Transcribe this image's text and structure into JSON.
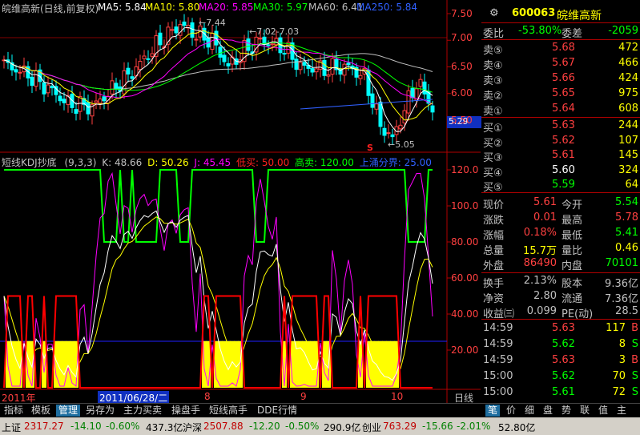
{
  "header": {
    "stock_title": "皖维高新(日线,前复权)",
    "ma": [
      {
        "label": "MA5: 5.84",
        "color": "#ffffff"
      },
      {
        "label": "MA10: 5.80",
        "color": "#ffff00"
      },
      {
        "label": "MA20: 5.85",
        "color": "#ff00ff"
      },
      {
        "label": "MA30: 5.97",
        "color": "#00ff00"
      },
      {
        "label": "MA60: 6.41",
        "color": "#c0c0c0"
      },
      {
        "label": "MA250: 5.84",
        "color": "#3060ff"
      }
    ]
  },
  "indicator": {
    "name": "短线KDJ抄底",
    "params": "(9,3,3)",
    "k": "K: 48.66",
    "d": "D: 50.26",
    "j": "J: 45.45",
    "dimai": "低买: 50.00",
    "gaomai": "高卖: 120.00",
    "shangyong": "上涌分界: 25.00"
  },
  "annotations": {
    "high1": "7.44",
    "high2": "7.02-7.03",
    "low1": "5.05",
    "s_mark": "S",
    "price_tag": "5.29"
  },
  "price_axis": [
    "7.50",
    "7.00",
    "6.50",
    "6.00",
    "5.50"
  ],
  "kdj_axis": [
    "120.0",
    "100.0",
    "80.00",
    "60.00",
    "40.00",
    "20.00"
  ],
  "date_axis": {
    "year": "2011年",
    "cursor_date": "2011/06/28/二",
    "months": [
      "8",
      "9",
      "10"
    ],
    "period": "日线"
  },
  "quote": {
    "code": "600063",
    "name": "皖维高新",
    "webi_label": "委比",
    "webi_value": "-53.80%",
    "weicha_label": "委差",
    "weicha_value": "-2059",
    "sell": [
      {
        "label": "卖⑤",
        "price": "5.68",
        "vol": "472"
      },
      {
        "label": "卖④",
        "price": "5.67",
        "vol": "466"
      },
      {
        "label": "卖③",
        "price": "5.66",
        "vol": "424"
      },
      {
        "label": "卖②",
        "price": "5.65",
        "vol": "975"
      },
      {
        "label": "卖①",
        "price": "5.64",
        "vol": "608"
      }
    ],
    "buy": [
      {
        "label": "买①",
        "price": "5.63",
        "vol": "244"
      },
      {
        "label": "买②",
        "price": "5.62",
        "vol": "107"
      },
      {
        "label": "买③",
        "price": "5.61",
        "vol": "145"
      },
      {
        "label": "买④",
        "price": "5.60",
        "vol": "324"
      },
      {
        "label": "买⑤",
        "price": "5.59",
        "vol": "64"
      }
    ],
    "stats": [
      {
        "l1": "现价",
        "v1": "5.61",
        "c1": "#ff4040",
        "l2": "今开",
        "v2": "5.54",
        "c2": "#00ff00"
      },
      {
        "l1": "涨跌",
        "v1": "0.01",
        "c1": "#ff4040",
        "l2": "最高",
        "v2": "5.78",
        "c2": "#ff4040"
      },
      {
        "l1": "涨幅",
        "v1": "0.18%",
        "c1": "#ff4040",
        "l2": "最低",
        "v2": "5.41",
        "c2": "#00ff00"
      },
      {
        "l1": "总量",
        "v1": "15.7万",
        "c1": "#ffff00",
        "l2": "量比",
        "v2": "0.46",
        "c2": "#ffff00"
      },
      {
        "l1": "外盘",
        "v1": "86490",
        "c1": "#ff4040",
        "l2": "内盘",
        "v2": "70101",
        "c2": "#00ff00"
      }
    ],
    "stats2": [
      {
        "l1": "换手",
        "v1": "2.13%",
        "l2": "股本",
        "v2": "9.36亿"
      },
      {
        "l1": "净资",
        "v1": "2.80",
        "l2": "流通",
        "v2": "7.36亿"
      },
      {
        "l1": "收益㈢",
        "v1": "0.099",
        "l2": "PE(动)",
        "v2": "28.5"
      }
    ],
    "ticks": [
      {
        "time": "14:59",
        "price": "5.63",
        "vol": "117",
        "side": "B",
        "color": "#ff4040"
      },
      {
        "time": "14:59",
        "price": "5.62",
        "vol": "8",
        "side": "S",
        "color": "#00ff00"
      },
      {
        "time": "14:59",
        "price": "5.63",
        "vol": "3",
        "side": "B",
        "color": "#ff4040"
      },
      {
        "time": "15:00",
        "price": "5.62",
        "vol": "70",
        "side": "S",
        "color": "#00ff00"
      },
      {
        "time": "15:00",
        "price": "5.61",
        "vol": "72",
        "side": "S",
        "color": "#00ff00"
      }
    ]
  },
  "tabs": [
    "指标",
    "模板",
    "管理",
    "另存为",
    "主力买卖",
    "操盘手",
    "短线高手",
    "DDE行情"
  ],
  "right_tabs": [
    "笔",
    "价",
    "细",
    "盘",
    "势",
    "联",
    "值",
    "主"
  ],
  "status": {
    "sh_label": "上证",
    "sh_val": "2317.27",
    "sh_chg": "-14.10",
    "sh_pct": "-0.60%",
    "sh_amt": "437.3亿",
    "sz_label": "沪深",
    "sz_val": "2507.88",
    "sz_chg": "-12.20",
    "sz_pct": "-0.50%",
    "sz_amt": "290.9亿",
    "cy_label": "创业",
    "cy_val": "763.29",
    "cy_chg": "-15.66",
    "cy_pct": "-2.01%",
    "cy_amt": "52.80亿"
  },
  "colors": {
    "up": "#ff4040",
    "down": "#00ffff",
    "grid": "#b00000"
  }
}
